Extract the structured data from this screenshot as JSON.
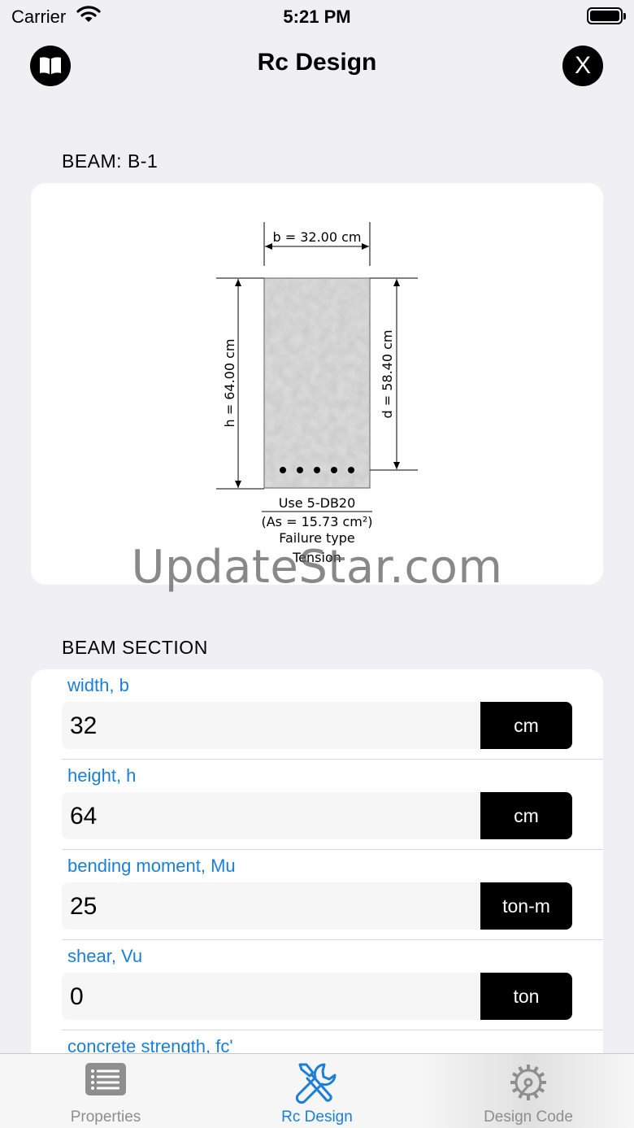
{
  "status_bar": {
    "carrier": "Carrier",
    "time": "5:21 PM"
  },
  "nav": {
    "title": "Rc Design",
    "close_label": "X",
    "left_icon": "book-icon"
  },
  "beam": {
    "section_title": "BEAM: B-1",
    "b_label": "b = 32.00 cm",
    "h_label": "h = 64.00 cm",
    "d_label": "d = 58.40 cm",
    "rebar_label": "Use 5-DB20",
    "as_label": "(As = 15.73 cm²)",
    "failure_label": "Failure type",
    "failure_value": "Tension",
    "bar_count": 5
  },
  "watermark": "UpdateStar.com",
  "form": {
    "section_title": "BEAM SECTION",
    "fields": [
      {
        "label": "width, b",
        "value": "32",
        "unit": "cm"
      },
      {
        "label": "height, h",
        "value": "64",
        "unit": "cm"
      },
      {
        "label": "bending moment, Mu",
        "value": "25",
        "unit": "ton-m"
      },
      {
        "label": "shear, Vu",
        "value": "0",
        "unit": "ton"
      },
      {
        "label": "concrete strength, fc'"
      }
    ]
  },
  "tabs": [
    {
      "label": "Properties",
      "icon": "list-icon"
    },
    {
      "label": "Rc Design",
      "icon": "tools-icon"
    },
    {
      "label": "Design Code",
      "icon": "gear-icon"
    }
  ],
  "colors": {
    "accent": "#1a7fd6",
    "background": "#efeff4",
    "card": "#ffffff",
    "dark": "#000000"
  }
}
